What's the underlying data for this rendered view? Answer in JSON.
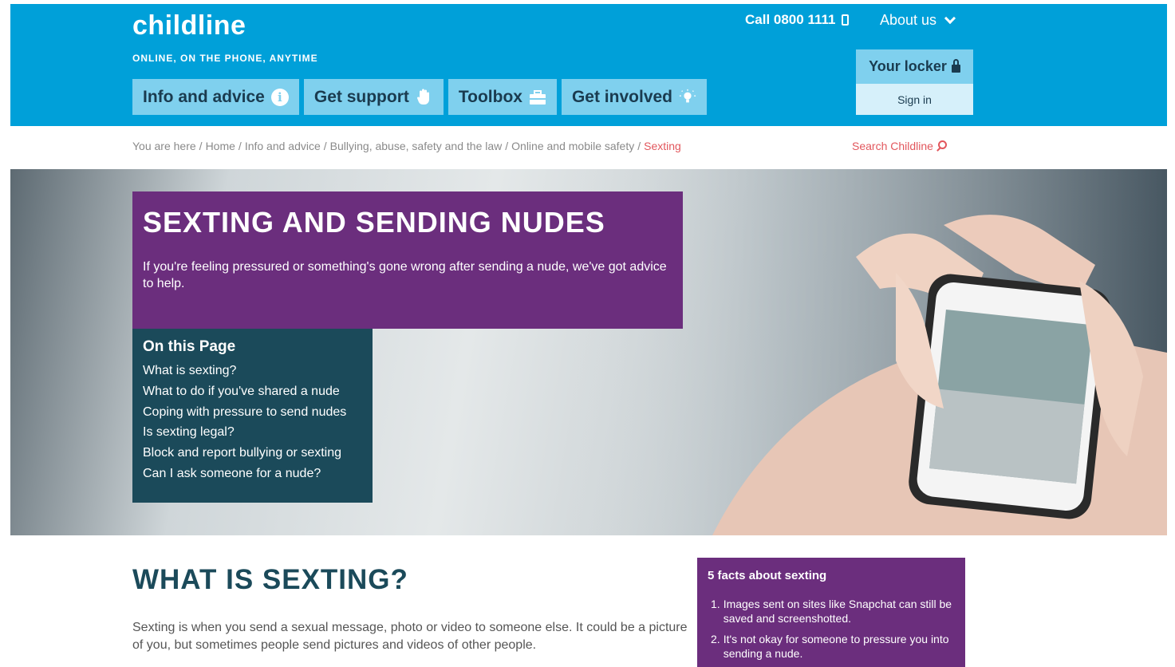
{
  "header": {
    "logo": "childline",
    "tagline": "ONLINE, ON THE PHONE, ANYTIME",
    "call": "Call 0800 1111",
    "about": "About us",
    "nav": [
      {
        "label": "Info and advice",
        "icon": "info-icon"
      },
      {
        "label": "Get support",
        "icon": "hand-icon"
      },
      {
        "label": "Toolbox",
        "icon": "toolbox-icon"
      },
      {
        "label": "Get involved",
        "icon": "lightbulb-icon"
      }
    ],
    "locker": {
      "label": "Your locker",
      "sign_in": "Sign in"
    }
  },
  "breadcrumb": {
    "items": [
      "You are here",
      "Home",
      "Info and advice",
      "Bullying, abuse, safety and the law",
      "Online and mobile safety"
    ],
    "current": "Sexting"
  },
  "search": {
    "label": "Search Childline"
  },
  "hero": {
    "title": "SEXTING AND SENDING NUDES",
    "subtitle": "If you're feeling pressured or something's gone wrong after sending a nude, we've got advice to help."
  },
  "on_this_page": {
    "title": "On this Page",
    "links": [
      "What is sexting?",
      "What to do if you've shared a nude",
      "Coping with pressure to send nudes",
      "Is sexting legal?",
      "Block and report bullying or sexting",
      "Can I ask someone for a nude?"
    ]
  },
  "section": {
    "title": "WHAT IS SEXTING?",
    "body": "Sexting is when you send a sexual message, photo or video to someone else. It could be a picture of you, but sometimes people send pictures and videos of other people."
  },
  "facts": {
    "title": "5 facts about sexting",
    "items": [
      {
        "num": "1.",
        "text": "Images sent on sites like Snapchat can still be saved and screenshotted."
      },
      {
        "num": "2.",
        "text": "It's not okay for someone to pressure you into sending a nude."
      }
    ]
  },
  "colors": {
    "header_blue": "#00a0d9",
    "nav_light_blue": "#7fd0ee",
    "purple": "#6b2e7d",
    "teal": "#1b4a5a",
    "link_red": "#e2575d"
  }
}
